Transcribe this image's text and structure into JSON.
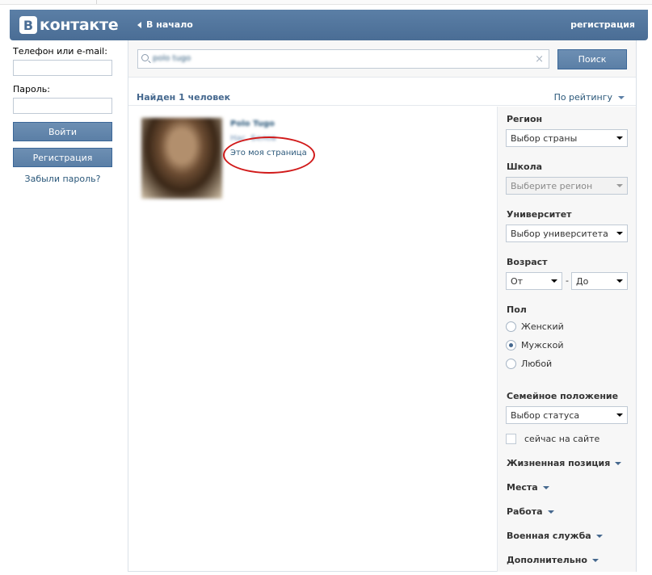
{
  "header": {
    "logo_letter": "В",
    "logo_text": "контакте",
    "back_label": "В начало",
    "register_label": "регистрация"
  },
  "login": {
    "phone_label": "Телефон или e-mail:",
    "password_label": "Пароль:",
    "login_button": "Войти",
    "register_button": "Регистрация",
    "forgot_link": "Забыли пароль?"
  },
  "search": {
    "query": "polo tugo",
    "clear_icon": "×",
    "button": "Поиск"
  },
  "results": {
    "found_text": "Найден 1 человек",
    "sort_label": "По рейтингу",
    "items": [
      {
        "name": "Polo Tugo",
        "subtitle": "Нас. Белов",
        "note": "Это моя страница"
      }
    ]
  },
  "filters": {
    "region": {
      "label": "Регион",
      "value": "Выбор страны"
    },
    "school": {
      "label": "Школа",
      "value": "Выберите регион"
    },
    "university": {
      "label": "Университет",
      "value": "Выбор университета"
    },
    "age": {
      "label": "Возраст",
      "from": "От",
      "separator": "-",
      "to": "До"
    },
    "gender": {
      "label": "Пол",
      "options": [
        "Женский",
        "Мужской",
        "Любой"
      ],
      "selected": "Мужской"
    },
    "marital": {
      "label": "Семейное положение",
      "value": "Выбор статуса"
    },
    "online_now": {
      "label": "сейчас на сайте",
      "checked": false
    },
    "expanders": [
      "Жизненная позиция",
      "Места",
      "Работа",
      "Военная служба",
      "Дополнительно"
    ]
  },
  "colors": {
    "header_blue": "#4a6d95",
    "link_blue": "#2b587a",
    "annotation_red": "#d11a1a"
  }
}
